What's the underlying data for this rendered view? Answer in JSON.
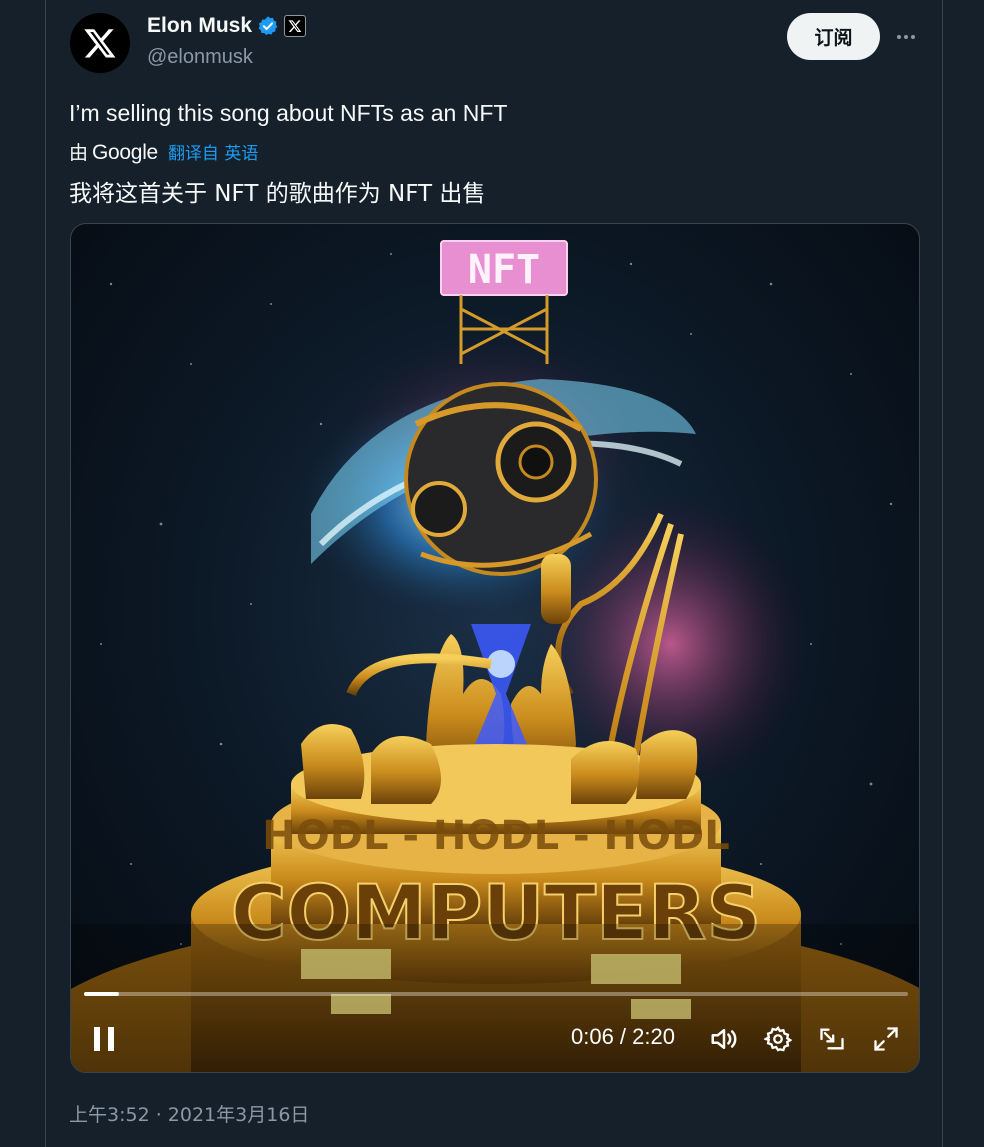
{
  "author": {
    "name": "Elon Musk",
    "handle": "@elonmusk",
    "verified": true,
    "avatar_icon": "x-logo-icon",
    "affiliate_badge_icon": "x-logo-icon"
  },
  "actions": {
    "subscribe_label": "订阅",
    "more_icon": "more-horizontal-icon"
  },
  "tweet": {
    "text": "I’m selling this song about NFTs as an NFT",
    "translation": {
      "by_label": "由",
      "provider": "Google",
      "link_label": "翻译自 英语",
      "translated_text": "我将这首关于 NFT 的歌曲作为 NFT 出售"
    },
    "timestamp": "上午3:52 · 2021年3月16日"
  },
  "video": {
    "current_time": "0:06",
    "duration": "2:20",
    "time_display": "0:06 / 2:20",
    "progress": 0.043,
    "scene_sign": "NFT",
    "scene_ring_text": "HODL - HODL - HODL",
    "scene_base_text": "COMPUTERS",
    "controls": {
      "play_state": "playing",
      "icons": [
        "pause-icon",
        "volume-icon",
        "settings-icon",
        "pip-icon",
        "fullscreen-icon"
      ]
    }
  },
  "colors": {
    "background": "#15202b",
    "accent": "#1d9bf0",
    "secondary_text": "#8b98a5",
    "gold": "#d9a12b"
  }
}
